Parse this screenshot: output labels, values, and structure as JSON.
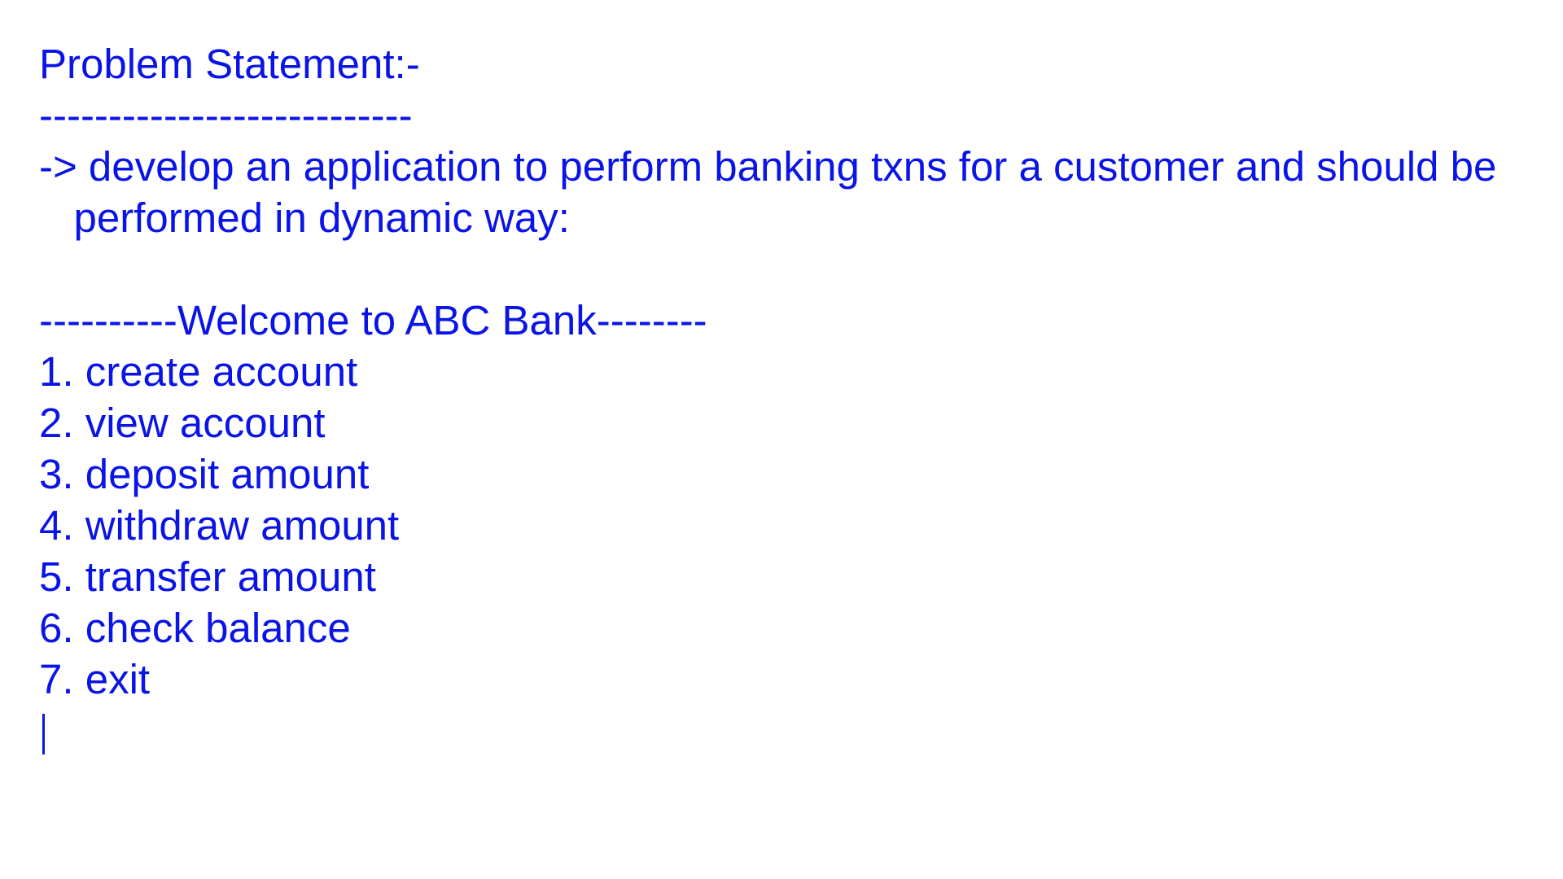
{
  "document": {
    "heading": "Problem Statement:-",
    "heading_rule": "---------------------------",
    "statement_line1": "-> develop an application to perform banking txns for a customer and should be",
    "statement_line2": "   performed in dynamic way:",
    "menu_title": "----------Welcome to ABC Bank--------",
    "menu_items": [
      "1. create account",
      "2. view account",
      "3. deposit amount",
      "4. withdraw amount",
      "5. transfer amount",
      "6. check balance",
      "7. exit"
    ]
  },
  "colors": {
    "text": "#0a14e6",
    "background": "#ffffff"
  }
}
